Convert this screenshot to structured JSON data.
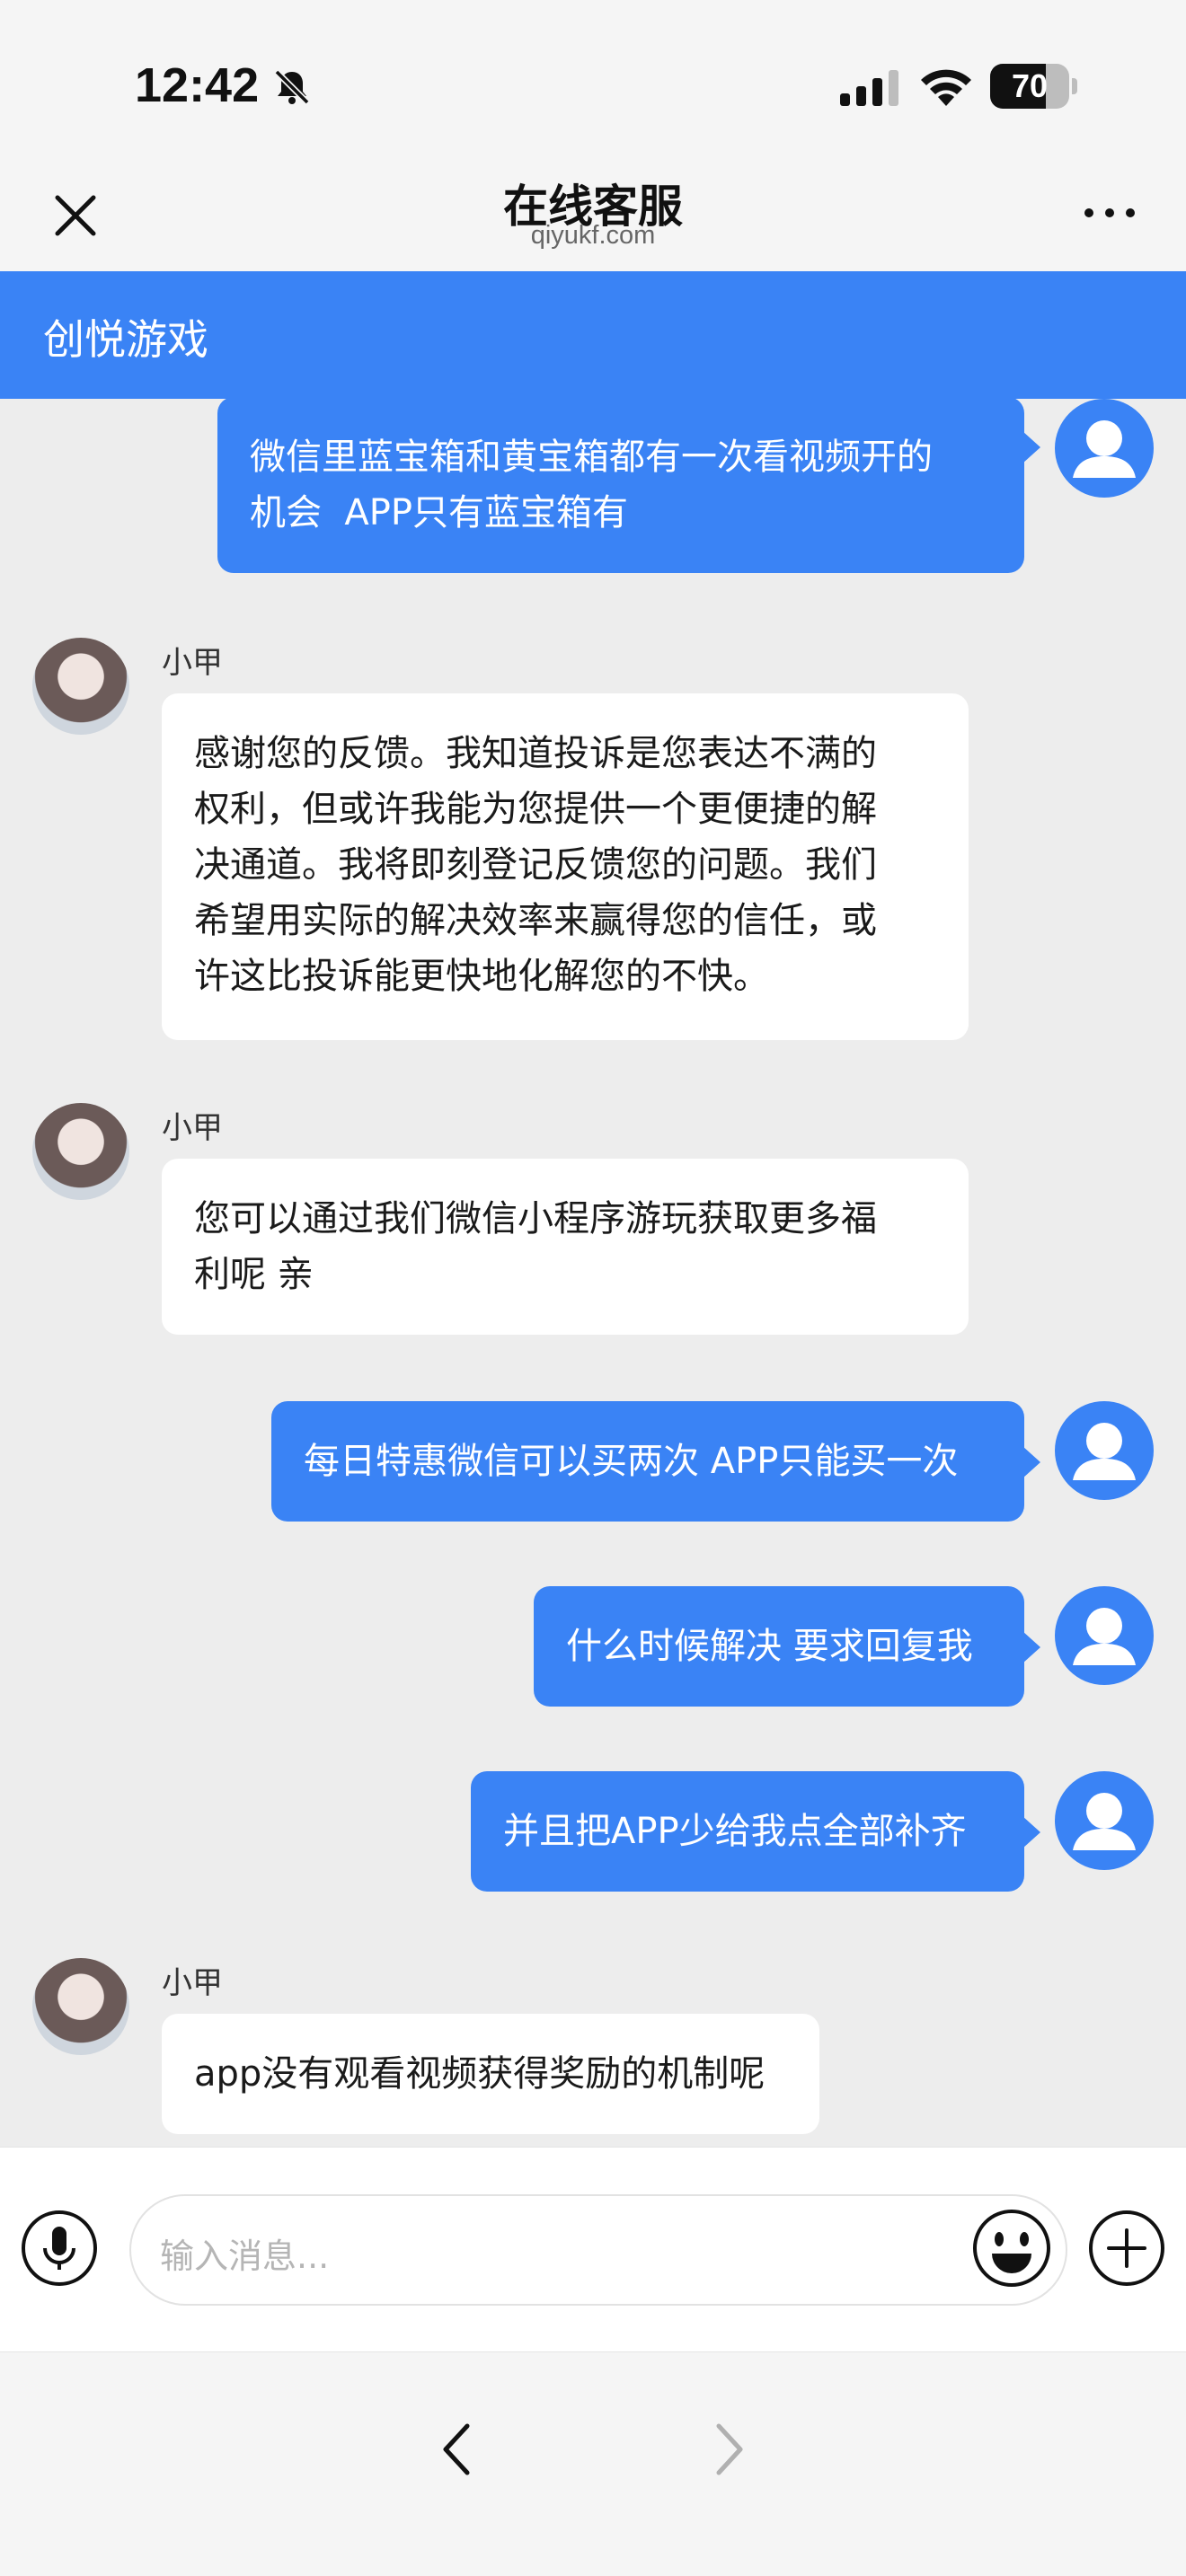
{
  "status_bar": {
    "time": "12:42",
    "battery": "70",
    "battery_level": 0.7
  },
  "nav": {
    "title": "在线客服",
    "subtitle": "qiyukf.com"
  },
  "brand": {
    "title": "创悦游戏"
  },
  "messages": [
    {
      "side": "out",
      "text": "微信里蓝宝箱和黄宝箱都有一次看视频开的\n机会  APP只有蓝宝箱有"
    },
    {
      "side": "in",
      "name": "小甲",
      "text": "感谢您的反馈。我知道投诉是您表达不满的\n权利，但或许我能为您提供一个更便捷的解\n决通道。我将即刻登记反馈您的问题。我们\n希望用实际的解决效率来赢得您的信任，或\n许这比投诉能更快地化解您的不快。"
    },
    {
      "side": "in",
      "name": "小甲",
      "text": "您可以通过我们微信小程序游玩获取更多福\n利呢 亲"
    },
    {
      "side": "out",
      "text": "每日特惠微信可以买两次 APP只能买一次"
    },
    {
      "side": "out",
      "text": "什么时候解决 要求回复我"
    },
    {
      "side": "out",
      "text": "并且把APP少给我点全部补齐"
    },
    {
      "side": "in",
      "name": "小甲",
      "text": "app没有观看视频获得奖励的机制呢"
    }
  ],
  "input": {
    "placeholder": "输入消息..."
  },
  "colors": {
    "accent": "#3a83f5",
    "background": "#ededed"
  },
  "icons": {
    "close": "close-icon",
    "more": "more-icon",
    "mic": "microphone-icon",
    "emoji": "emoji-icon",
    "plus": "plus-icon",
    "back": "chevron-left-icon",
    "forward": "chevron-right-icon"
  }
}
